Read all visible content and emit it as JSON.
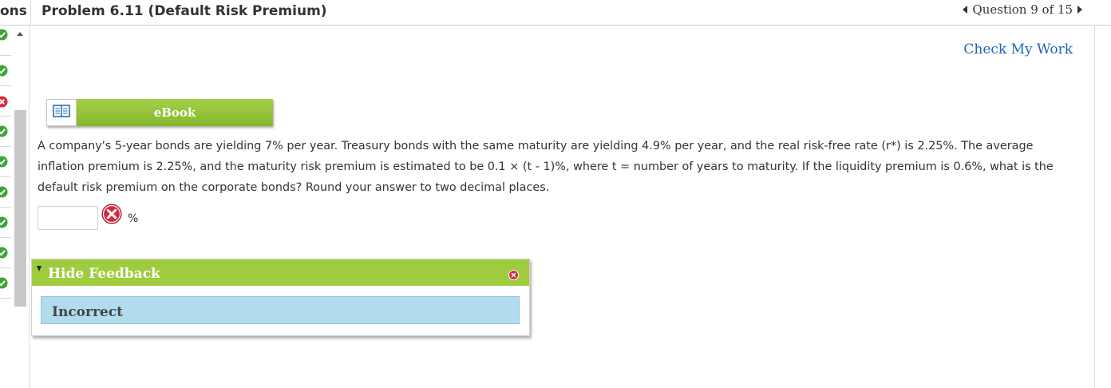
{
  "header": {
    "section_label": "ons",
    "title": "Problem 6.11 (Default Risk Premium)",
    "question_nav": "Question 9 of 15",
    "nav_icons": [
      "prev-question-icon",
      "next-question-icon"
    ]
  },
  "rail": {
    "items": [
      {
        "status": "correct",
        "icon": "check-circle-icon"
      },
      {
        "status": "correct",
        "icon": "check-circle-icon"
      },
      {
        "status": "incorrect",
        "icon": "x-circle-icon"
      },
      {
        "status": "correct",
        "icon": "check-circle-icon"
      },
      {
        "status": "correct",
        "icon": "check-circle-icon"
      },
      {
        "status": "correct",
        "icon": "check-circle-icon"
      },
      {
        "status": "correct",
        "icon": "check-circle-icon"
      },
      {
        "status": "correct",
        "icon": "check-circle-icon"
      },
      {
        "status": "correct",
        "icon": "check-circle-icon"
      }
    ]
  },
  "actions": {
    "check_my_work": "Check My Work"
  },
  "ebook": {
    "label": "eBook",
    "icon": "open-book-icon"
  },
  "problem": {
    "text": "A company's 5-year bonds are yielding 7% per year. Treasury bonds with the same maturity are yielding 4.9% per year, and the real risk-free rate (r*) is 2.25%. The average inflation premium is 2.25%, and the maturity risk premium is estimated to be 0.1 × (t - 1)%, where t = number of years to maturity. If the liquidity premium is 0.6%, what is the default risk premium on the corporate bonds? Round your answer to two decimal places."
  },
  "answer": {
    "value": "",
    "unit": "%",
    "status_icon": "incorrect-x-icon"
  },
  "feedback": {
    "toggle_label": "Hide Feedback",
    "result": "Incorrect"
  },
  "colors": {
    "green_accent": "#9fcb3f",
    "link_blue": "#1b65b5",
    "correct_green": "#3aa635",
    "incorrect_red": "#d9283f",
    "feedback_blue": "#b2dcee"
  }
}
